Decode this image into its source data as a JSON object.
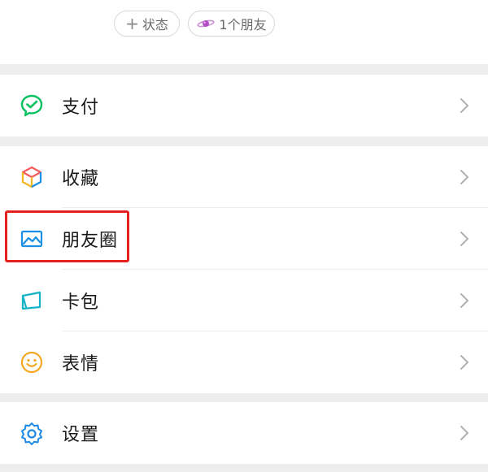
{
  "profile": {
    "status_chip_label": "状态",
    "friends_chip_label": "1个朋友"
  },
  "menu": {
    "pay": {
      "label": "支付",
      "icon": "wechat-pay-icon"
    },
    "favorites": {
      "label": "收藏",
      "icon": "cube-icon"
    },
    "moments": {
      "label": "朋友圈",
      "icon": "image-icon"
    },
    "cards": {
      "label": "卡包",
      "icon": "card-wallet-icon"
    },
    "stickers": {
      "label": "表情",
      "icon": "smiley-icon"
    },
    "settings": {
      "label": "设置",
      "icon": "gear-icon"
    }
  },
  "colors": {
    "pay_green": "#07c160",
    "moments_blue": "#1b8fe3",
    "cards_teal": "#16b3c8",
    "stickers_yellow": "#f5a623",
    "settings_blue": "#1e8ae8",
    "highlight_red": "#e5211d"
  }
}
